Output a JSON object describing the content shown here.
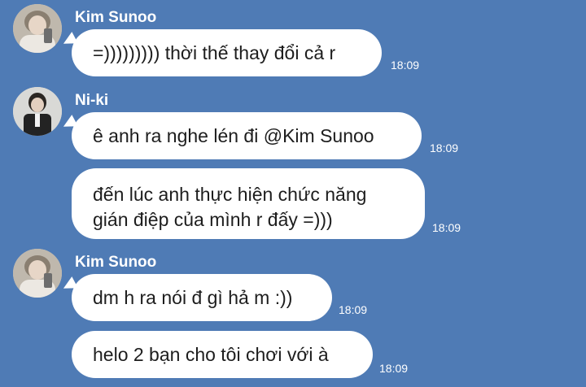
{
  "messages": [
    {
      "sender": "Kim Sunoo",
      "text": "=))))))))) thời thế thay đổi cả r",
      "time": "18:09"
    },
    {
      "sender": "Ni-ki",
      "text": "ê anh ra nghe lén đi @Kim Sunoo",
      "time": "18:09"
    },
    {
      "sender": "Ni-ki",
      "text_lines": [
        "đến lúc anh thực hiện chức năng",
        "gián điệp của mình r đấy =)))"
      ],
      "time": "18:09"
    },
    {
      "sender": "Kim Sunoo",
      "text": "dm h ra nói đ gì hả m :))",
      "time": "18:09"
    },
    {
      "sender": "Kim Sunoo",
      "text": "helo 2 bạn cho tôi chơi với à",
      "time": "18:09"
    }
  ],
  "colors": {
    "background": "#4f7bb5",
    "bubble": "#ffffff",
    "text": "#1d1d1d"
  }
}
